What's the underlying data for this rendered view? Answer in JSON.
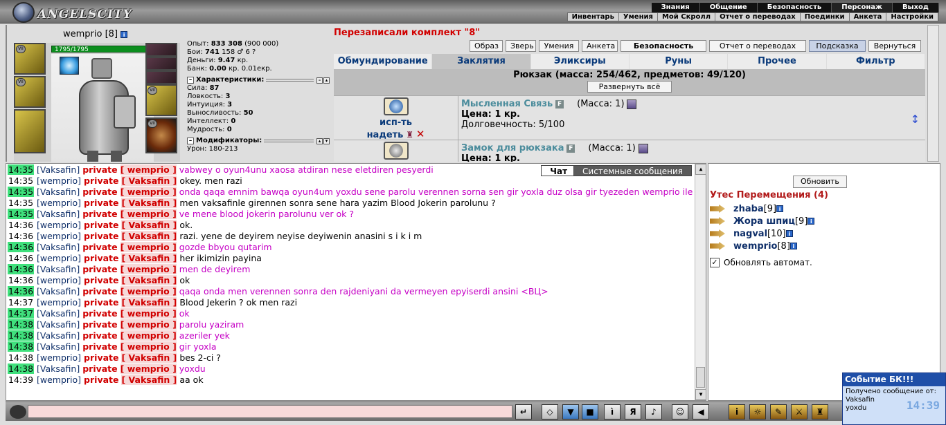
{
  "header": {
    "logo": "ANGELSCITY",
    "main_menu": [
      "Знания",
      "Общение",
      "Безопасность",
      "Персонаж",
      "Выход"
    ],
    "sub_menu": [
      "Инвентарь",
      "Умения",
      "Мой Скролл",
      "Отчет о переводах",
      "Поединки",
      "Анкета",
      "Настройки"
    ]
  },
  "character": {
    "name": "wemprio",
    "level": "[8]",
    "hp": "1795/1795",
    "stats_top": [
      {
        "label": "Опыт:",
        "value": "833 308",
        "extra": "(900 000)"
      },
      {
        "label": "Бои:",
        "value": "741",
        "extra": "158 ♂ 6 ?"
      },
      {
        "label": "Деньги:",
        "value": "9.47",
        "extra": "кр."
      },
      {
        "label": "Банк:",
        "value": "0.00",
        "extra": "кр. 0.01екр."
      }
    ],
    "characteristics_title": "Характеристики:",
    "characteristics": [
      {
        "label": "Сила:",
        "value": "87"
      },
      {
        "label": "Ловкость:",
        "value": "3"
      },
      {
        "label": "Интуиция:",
        "value": "3"
      },
      {
        "label": "Выносливость:",
        "value": "50"
      },
      {
        "label": "Интеллект:",
        "value": "0"
      },
      {
        "label": "Мудрость:",
        "value": "0"
      }
    ],
    "modifiers_title": "Модификаторы:",
    "modifiers": [
      {
        "label": "Урон:",
        "value": "180-213"
      }
    ],
    "slot_level": "VII"
  },
  "inventory": {
    "kit_message": "Перезаписали комплект \"8\"",
    "buttons": [
      "Образ",
      "Зверь",
      "Умения",
      "Анкета",
      "Безопасность",
      "Отчет о переводах",
      "Подсказка",
      "Вернуться"
    ],
    "tabs": [
      "Обмундирование",
      "Заклятия",
      "Эликсиры",
      "Руны",
      "Прочее",
      "Фильтр"
    ],
    "backpack_title": "Рюкзак (масса: 254/462, предметов: 49/120)",
    "expand_all": "Развернуть всё",
    "items": [
      {
        "action1": "исп-ть",
        "action2": "надеть",
        "name": "Мысленная Связь",
        "badge": "F",
        "mass": "(Масса: 1)",
        "price": "Цена: 1 кр.",
        "durability": "Долговечность: 5/100"
      },
      {
        "name": "Замок для рюкзака",
        "badge": "F",
        "mass": "(Масса: 1)",
        "price": "Цена: 1 кр."
      }
    ]
  },
  "chat": {
    "tabs": [
      "Чат",
      "Системные сообщения"
    ],
    "lines": [
      {
        "t": "14:35",
        "hl": true,
        "from": "[Vaksafin]",
        "to": "[ wemprio ]",
        "msg": "vabwey o oyun4unu xaosa atdiran nese eletdiren pesyerdi",
        "self": false
      },
      {
        "t": "14:35",
        "hl": false,
        "from": "[wemprio]",
        "to": "[ Vaksafin ]",
        "msg": "okey. men razi",
        "self": true
      },
      {
        "t": "14:35",
        "hl": true,
        "from": "[Vaksafin]",
        "to": "[ wemprio ]",
        "msg": "onda qaqa emnim bawqa oyun4um yoxdu sene parolu verennen sorna sen gir yoxla duz olsa gir tyezeden wemprio ile",
        "self": false
      },
      {
        "t": "14:35",
        "hl": false,
        "from": "[wemprio]",
        "to": "[ Vaksafin ]",
        "msg": "men vaksafinle girennen sonra sene hara yazim Blood Jokerin parolunu ?",
        "self": true
      },
      {
        "t": "14:35",
        "hl": true,
        "from": "[Vaksafin]",
        "to": "[ wemprio ]",
        "msg": "ve mene blood jokerin parolunu ver ok ?",
        "self": false
      },
      {
        "t": "14:36",
        "hl": false,
        "from": "[wemprio]",
        "to": "[ Vaksafin ]",
        "msg": "ok.",
        "self": true
      },
      {
        "t": "14:36",
        "hl": false,
        "from": "[wemprio]",
        "to": "[ Vaksafin ]",
        "msg": "razi. yene de deyirem neyise deyiwenin anasini s i k i m",
        "self": true
      },
      {
        "t": "14:36",
        "hl": true,
        "from": "[Vaksafin]",
        "to": "[ wemprio ]",
        "msg": "gozde bbyou qutarim",
        "self": false
      },
      {
        "t": "14:36",
        "hl": false,
        "from": "[wemprio]",
        "to": "[ Vaksafin ]",
        "msg": "her ikimizin payina",
        "self": true
      },
      {
        "t": "14:36",
        "hl": true,
        "from": "[Vaksafin]",
        "to": "[ wemprio ]",
        "msg": "men de deyirem",
        "self": false
      },
      {
        "t": "14:36",
        "hl": false,
        "from": "[wemprio]",
        "to": "[ Vaksafin ]",
        "msg": "ok",
        "self": true
      },
      {
        "t": "14:36",
        "hl": true,
        "from": "[Vaksafin]",
        "to": "[ wemprio ]",
        "msg": "qaqa onda men verennen sonra den rajdeniyani da vermeyen epyiserdi ansini <ВЦ>",
        "self": false
      },
      {
        "t": "14:37",
        "hl": false,
        "from": "[wemprio]",
        "to": "[ Vaksafin ]",
        "msg": "Blood Jekerin ? ok men razi",
        "self": true
      },
      {
        "t": "14:37",
        "hl": true,
        "from": "[Vaksafin]",
        "to": "[ wemprio ]",
        "msg": "ok",
        "self": false
      },
      {
        "t": "14:38",
        "hl": true,
        "from": "[Vaksafin]",
        "to": "[ wemprio ]",
        "msg": "parolu yaziram",
        "self": false
      },
      {
        "t": "14:38",
        "hl": true,
        "from": "[Vaksafin]",
        "to": "[ wemprio ]",
        "msg": "azeriler yek",
        "self": false
      },
      {
        "t": "14:38",
        "hl": true,
        "from": "[Vaksafin]",
        "to": "[ wemprio ]",
        "msg": "gir yoxla",
        "self": false
      },
      {
        "t": "14:38",
        "hl": false,
        "from": "[wemprio]",
        "to": "[ Vaksafin ]",
        "msg": "bes 2-ci ?",
        "self": true
      },
      {
        "t": "14:38",
        "hl": true,
        "from": "[Vaksafin]",
        "to": "[ wemprio ]",
        "msg": "yoxdu",
        "self": false
      },
      {
        "t": "14:39",
        "hl": false,
        "from": "[wemprio]",
        "to": "[ Vaksafin ]",
        "msg": "aa ok",
        "self": true
      }
    ],
    "private_label": "private"
  },
  "online": {
    "refresh": "Обновить",
    "room": "Утес Перемещения (4)",
    "users": [
      {
        "name": "zhaba",
        "lvl": "[9]"
      },
      {
        "name": "Жора шпиц",
        "lvl": "[9]"
      },
      {
        "name": "nagval",
        "lvl": "[10]"
      },
      {
        "name": "wemprio",
        "lvl": "[8]"
      }
    ],
    "auto_refresh": "Обновлять автомат."
  },
  "notification": {
    "title": "Событие БК!!!",
    "text": "Получено сообщение от:",
    "sender": "Vaksafin",
    "msg": "yoxdu",
    "clock": "14:39"
  },
  "colors": {
    "accent": "#d10000",
    "link": "#10306a",
    "highlight": "#3fe07c",
    "other_msg": "#c500c5"
  }
}
